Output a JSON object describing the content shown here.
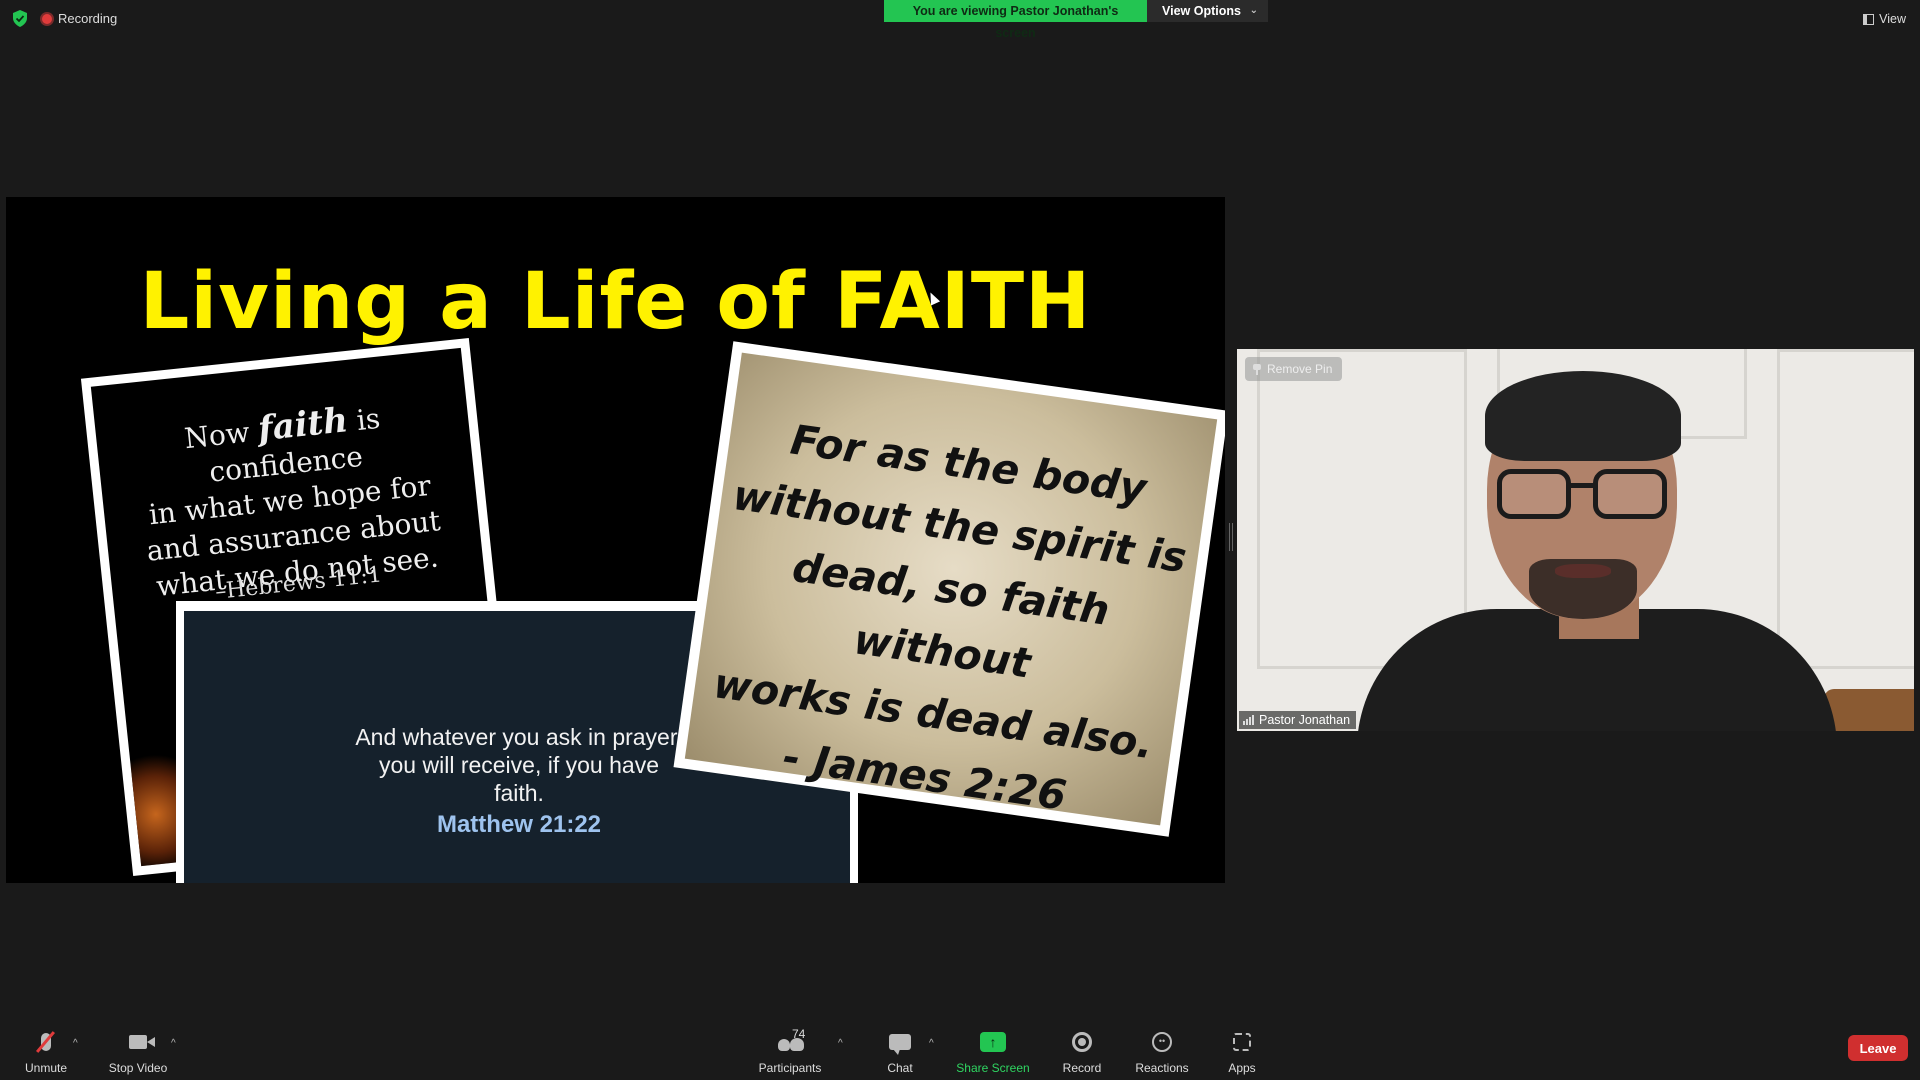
{
  "top_bar": {
    "recording_label": "Recording",
    "share_banner": "You are viewing Pastor Jonathan's screen",
    "view_options_label": "View Options",
    "view_label": "View"
  },
  "slide": {
    "title": "Living a Life of FAITH",
    "card1": {
      "line1a": "Now ",
      "line1b": "faith",
      "line1c": " is confidence",
      "line2": "in what we hope for",
      "line3": "and assurance about",
      "line4": "what we do not see.",
      "reference": "–Hebrews 11:1"
    },
    "card2": {
      "text": "And whatever you ask in prayer, you will receive, if you have faith.",
      "reference": "Matthew 21:22"
    },
    "card3": {
      "line1": "For as the body",
      "line2": "without the spirit is",
      "line3": "dead, so faith without",
      "line4": "works is dead also.",
      "line5": "- James 2:26"
    }
  },
  "video": {
    "remove_pin_label": "Remove Pin",
    "participant_name": "Pastor Jonathan"
  },
  "toolbar": {
    "unmute_label": "Unmute",
    "stop_video_label": "Stop Video",
    "participants_label": "Participants",
    "participants_count": "74",
    "chat_label": "Chat",
    "share_screen_label": "Share Screen",
    "record_label": "Record",
    "reactions_label": "Reactions",
    "apps_label": "Apps",
    "leave_label": "Leave"
  },
  "colors": {
    "share_green": "#23c552",
    "leave_red": "#d02f2f",
    "title_yellow": "#fff200"
  }
}
